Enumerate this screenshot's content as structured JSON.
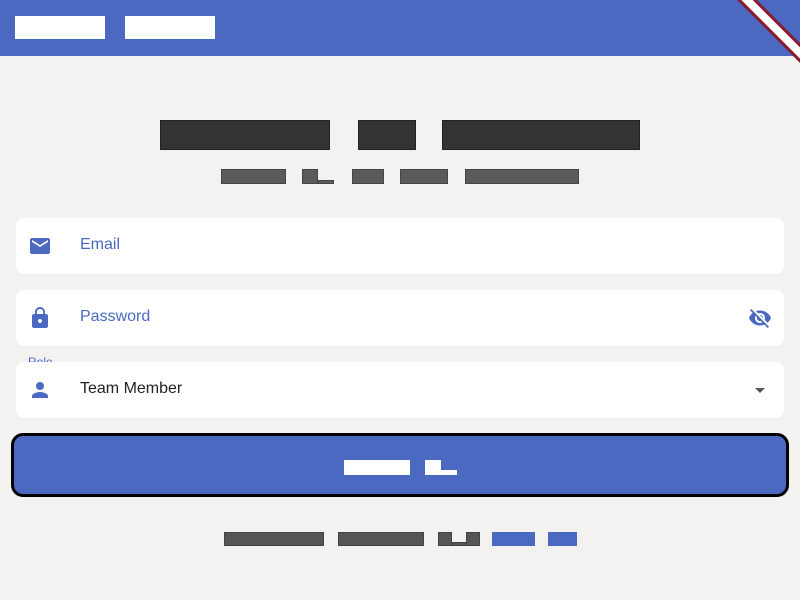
{
  "colors": {
    "primary": "#4b69c1",
    "background": "#f3f2f1",
    "field_background": "#ffffff",
    "button_border": "#000000",
    "debug_ribbon": "#8b1a2b"
  },
  "form": {
    "email": {
      "label": "Email",
      "icon": "mail-icon"
    },
    "password": {
      "label": "Password",
      "icon": "lock-icon",
      "trailing_icon": "visibility-off-icon"
    },
    "role": {
      "caption": "Role",
      "value": "Team Member",
      "icon": "person-icon",
      "trailing_icon": "arrow-drop-down-icon"
    }
  }
}
